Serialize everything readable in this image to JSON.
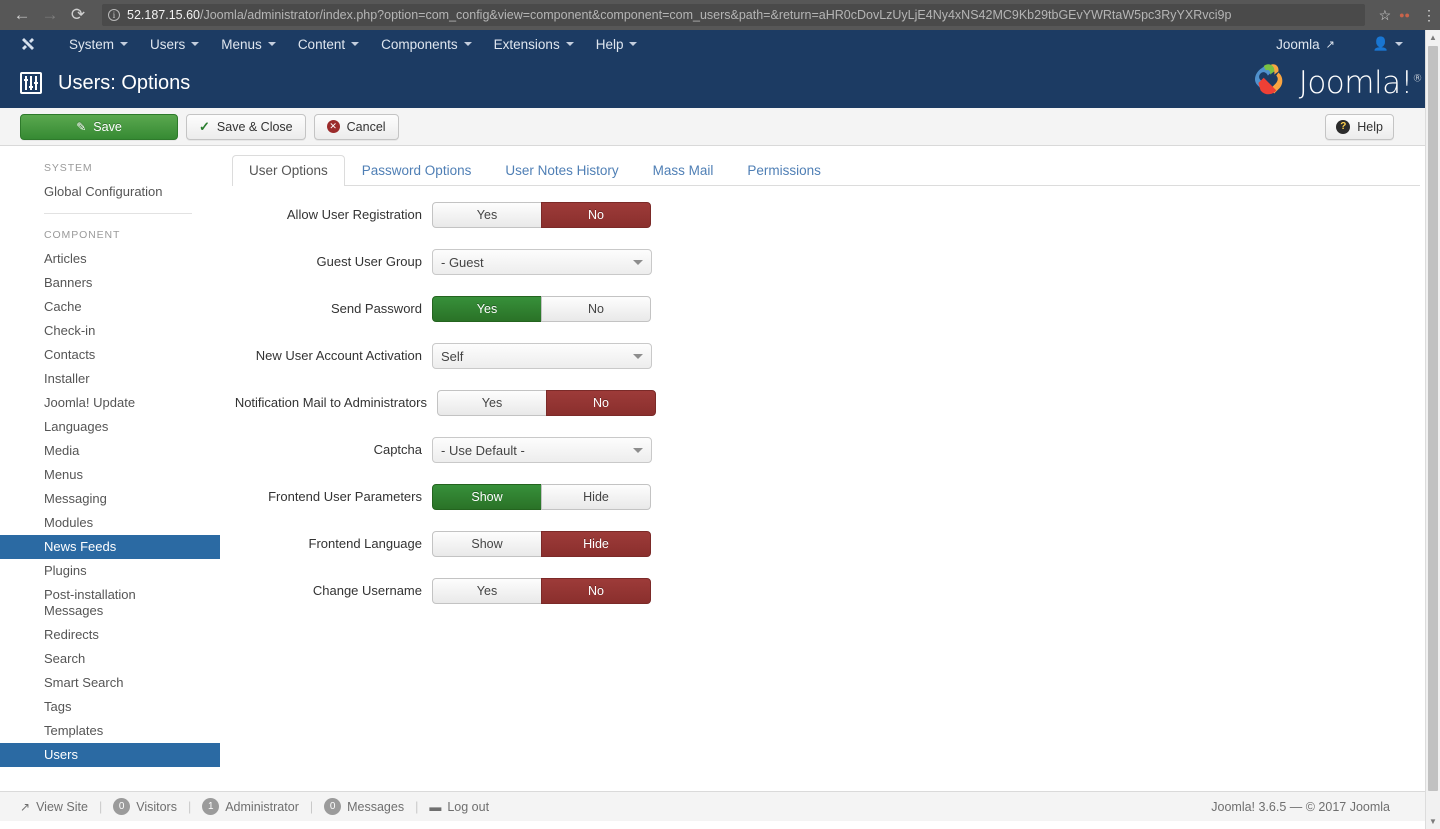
{
  "browser": {
    "back_icon": "back-arrow-icon",
    "forward_icon": "forward-arrow-icon",
    "reload_icon": "reload-icon",
    "info_glyph": "i",
    "url_host": "52.187.15.60",
    "url_path": "/Joomla/administrator/index.php?option=com_config&view=component&component=com_users&path=&return=aHR0cDovLzUyLjE4Ny4xNS42MC9Kb29tbGEvYWRtaW5pc3RyYXRvci9p",
    "star_glyph": "☆",
    "menu_glyph": "⋮"
  },
  "admin_menu": {
    "logo_icon": "joomla-logo-icon",
    "items": [
      {
        "label": "System",
        "caret": true
      },
      {
        "label": "Users",
        "caret": true
      },
      {
        "label": "Menus",
        "caret": true
      },
      {
        "label": "Content",
        "caret": true
      },
      {
        "label": "Components",
        "caret": true
      },
      {
        "label": "Extensions",
        "caret": true
      },
      {
        "label": "Help",
        "caret": true
      }
    ],
    "site_label": "Joomla",
    "site_external_icon": "external-link-icon",
    "user_icon": "user-icon"
  },
  "header": {
    "page_icon": "sliders-options-icon",
    "title": "Users: Options",
    "brand": "Joomla!",
    "brand_sup": "®"
  },
  "toolbar": {
    "save_label": "Save",
    "save_icon": "pencil-square-icon",
    "save_close_label": "Save & Close",
    "save_close_icon": "check-icon",
    "cancel_label": "Cancel",
    "cancel_icon": "cancel-circle-icon",
    "help_label": "Help",
    "help_icon": "question-circle-icon"
  },
  "sidebar": {
    "system_heading": "SYSTEM",
    "system_items": [
      {
        "label": "Global Configuration",
        "active": false
      }
    ],
    "component_heading": "COMPONENT",
    "component_items": [
      {
        "label": "Articles",
        "active": false
      },
      {
        "label": "Banners",
        "active": false
      },
      {
        "label": "Cache",
        "active": false
      },
      {
        "label": "Check-in",
        "active": false
      },
      {
        "label": "Contacts",
        "active": false
      },
      {
        "label": "Installer",
        "active": false
      },
      {
        "label": "Joomla! Update",
        "active": false
      },
      {
        "label": "Languages",
        "active": false
      },
      {
        "label": "Media",
        "active": false
      },
      {
        "label": "Menus",
        "active": false
      },
      {
        "label": "Messaging",
        "active": false
      },
      {
        "label": "Modules",
        "active": false
      },
      {
        "label": "News Feeds",
        "active": true
      },
      {
        "label": "Plugins",
        "active": false
      },
      {
        "label": "Post-installation Messages",
        "active": false
      },
      {
        "label": "Redirects",
        "active": false
      },
      {
        "label": "Search",
        "active": false
      },
      {
        "label": "Smart Search",
        "active": false
      },
      {
        "label": "Tags",
        "active": false
      },
      {
        "label": "Templates",
        "active": false
      },
      {
        "label": "Users",
        "active": true
      }
    ]
  },
  "tabs": [
    {
      "label": "User Options",
      "active": true
    },
    {
      "label": "Password Options",
      "active": false
    },
    {
      "label": "User Notes History",
      "active": false
    },
    {
      "label": "Mass Mail",
      "active": false
    },
    {
      "label": "Permissions",
      "active": false
    }
  ],
  "form": {
    "rows": [
      {
        "label": "Allow User Registration",
        "type": "toggle",
        "options": [
          "Yes",
          "No"
        ],
        "selected": "No",
        "state_color": "red"
      },
      {
        "label": "Guest User Group",
        "type": "select",
        "value": "- Guest"
      },
      {
        "label": "Send Password",
        "type": "toggle",
        "options": [
          "Yes",
          "No"
        ],
        "selected": "Yes",
        "state_color": "green"
      },
      {
        "label": "New User Account Activation",
        "type": "select",
        "value": "Self"
      },
      {
        "label": "Notification Mail to Administrators",
        "type": "toggle",
        "options": [
          "Yes",
          "No"
        ],
        "selected": "No",
        "state_color": "red",
        "wide_label": true
      },
      {
        "label": "Captcha",
        "type": "select",
        "value": "- Use Default -"
      },
      {
        "label": "Frontend User Parameters",
        "type": "toggle",
        "options": [
          "Show",
          "Hide"
        ],
        "selected": "Show",
        "state_color": "green"
      },
      {
        "label": "Frontend Language",
        "type": "toggle",
        "options": [
          "Show",
          "Hide"
        ],
        "selected": "Hide",
        "state_color": "red"
      },
      {
        "label": "Change Username",
        "type": "toggle",
        "options": [
          "Yes",
          "No"
        ],
        "selected": "No",
        "state_color": "red"
      }
    ]
  },
  "statusbar": {
    "view_site_label": "View Site",
    "view_site_icon": "external-link-icon",
    "visitors_count": "0",
    "visitors_label": "Visitors",
    "administrator_count": "1",
    "administrator_label": "Administrator",
    "messages_count": "0",
    "messages_label": "Messages",
    "logout_label": "Log out",
    "logout_icon": "logout-icon",
    "version": "Joomla! 3.6.5  —  © 2017 Joomla"
  },
  "colors": {
    "navy": "#1c3b63",
    "toggle_green": "#2a7227",
    "toggle_red": "#8a2f2d",
    "sidebar_active": "#2b6aa3",
    "save_green": "#368a33",
    "link_blue": "#4f7fb5"
  }
}
